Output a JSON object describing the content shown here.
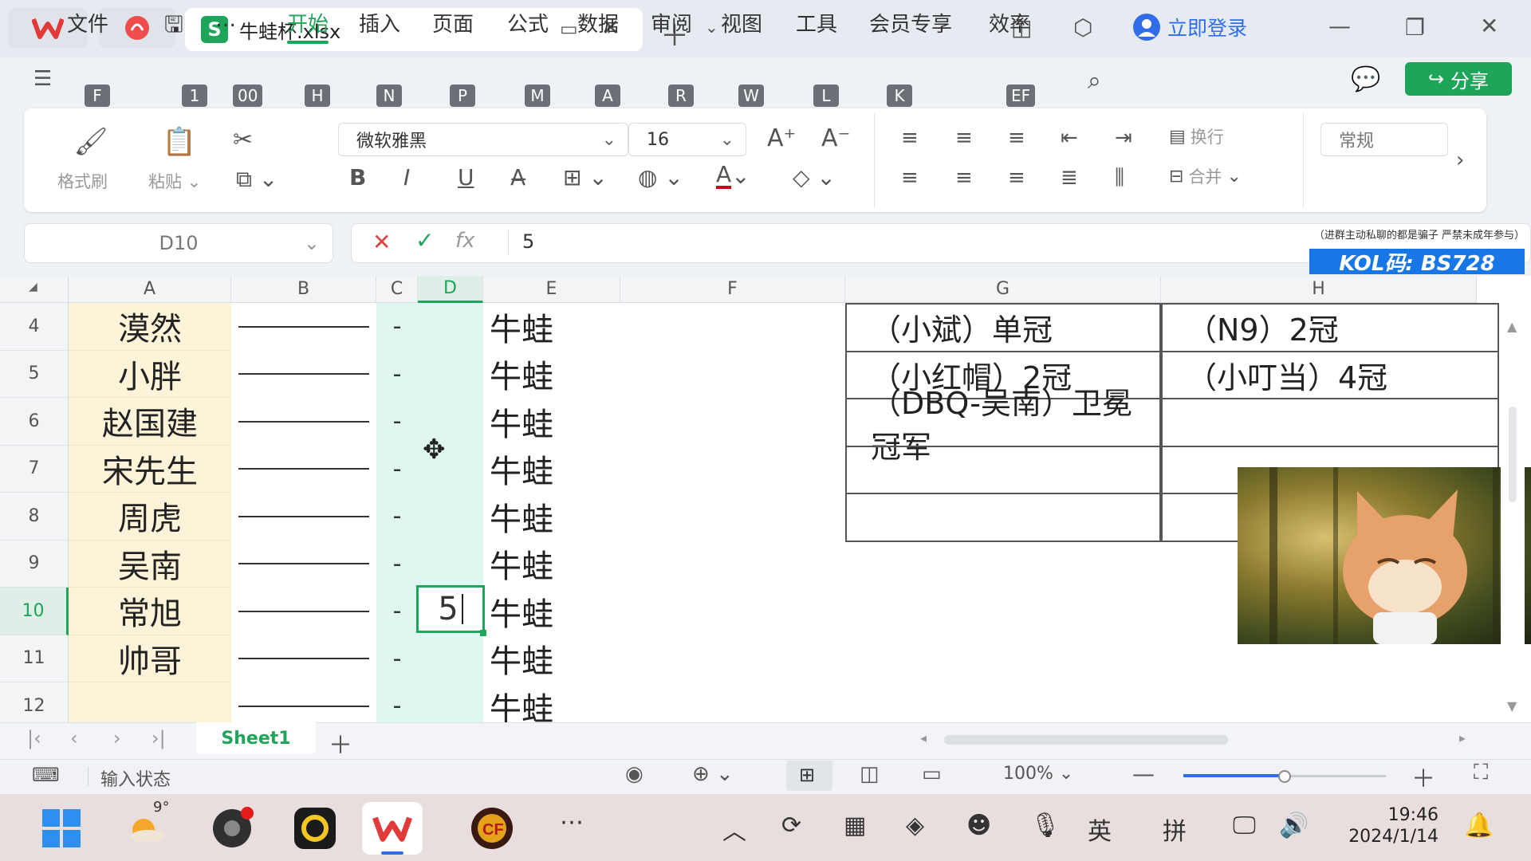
{
  "titlebar": {
    "doc_tab": "牛蛙杯.xlsx",
    "xls_letter": "S",
    "login": "立即登录"
  },
  "menu": {
    "items": [
      {
        "label": "文件",
        "key": "F"
      },
      {
        "label": "",
        "key": "1"
      },
      {
        "label": "…",
        "key": "00"
      },
      {
        "label": "开始",
        "key": "H"
      },
      {
        "label": "插入",
        "key": "N"
      },
      {
        "label": "页面",
        "key": "P"
      },
      {
        "label": "公式",
        "key": "M"
      },
      {
        "label": "数据",
        "key": "A"
      },
      {
        "label": "审阅",
        "key": "R"
      },
      {
        "label": "视图",
        "key": "W"
      },
      {
        "label": "工具",
        "key": "L"
      },
      {
        "label": "会员专享",
        "key": "K"
      },
      {
        "label": "效率",
        "key": "EF"
      }
    ],
    "share": "分享"
  },
  "ribbon": {
    "format_painter": "格式刷",
    "paste": "粘贴",
    "font_name": "微软雅黑",
    "font_size": "16",
    "wrap": "换行",
    "merge": "合并",
    "number_format": "常规"
  },
  "formula": {
    "cell_ref": "D10",
    "value": "5"
  },
  "grid": {
    "columns": [
      "A",
      "B",
      "C",
      "D",
      "E",
      "F",
      "G",
      "H"
    ],
    "rows": [
      {
        "num": "4",
        "a": "漠然",
        "c": "-",
        "d": "",
        "e": "牛蛙"
      },
      {
        "num": "5",
        "a": "小胖",
        "c": "-",
        "d": "",
        "e": "牛蛙"
      },
      {
        "num": "6",
        "a": "赵国建",
        "c": "-",
        "d": "",
        "e": "牛蛙"
      },
      {
        "num": "7",
        "a": "宋先生",
        "c": "-",
        "d": "",
        "e": "牛蛙"
      },
      {
        "num": "8",
        "a": "周虎",
        "c": "-",
        "d": "",
        "e": "牛蛙"
      },
      {
        "num": "9",
        "a": "吴南",
        "c": "-",
        "d": "",
        "e": "牛蛙"
      },
      {
        "num": "10",
        "a": "常旭",
        "c": "-",
        "d": "5",
        "e": "牛蛙"
      },
      {
        "num": "11",
        "a": "帅哥",
        "c": "-",
        "d": "",
        "e": "牛蛙"
      },
      {
        "num": "12",
        "a": "",
        "c": "-",
        "d": "",
        "e": "牛蛙"
      }
    ],
    "g_table": [
      {
        "g": "（小斌）单冠",
        "h": "（N9）2冠"
      },
      {
        "g": "（小红帽）2冠",
        "h": "（小叮当）4冠"
      },
      {
        "g": "（DBQ-吴南）卫冕冠军",
        "h": ""
      },
      {
        "g": "",
        "h": ""
      },
      {
        "g": "",
        "h": ""
      }
    ]
  },
  "overlay": {
    "notice": "（进群主动私聊的都是骗子 严禁未成年参与）",
    "kol": "KOL码: BS728"
  },
  "sheet": {
    "tab": "Sheet1"
  },
  "status": {
    "input_state": "输入状态",
    "zoom": "100%",
    "zoom_level": 0.5
  },
  "taskbar": {
    "weather": "9°",
    "lang1": "英",
    "lang2": "拼",
    "time": "19:46",
    "date": "2024/1/14"
  },
  "colors": {
    "accent": "#1ea55a",
    "col_a_fill": "#fdf3d8",
    "col_cd_fill": "#dff7f1",
    "kol_bg": "#1877e6"
  }
}
